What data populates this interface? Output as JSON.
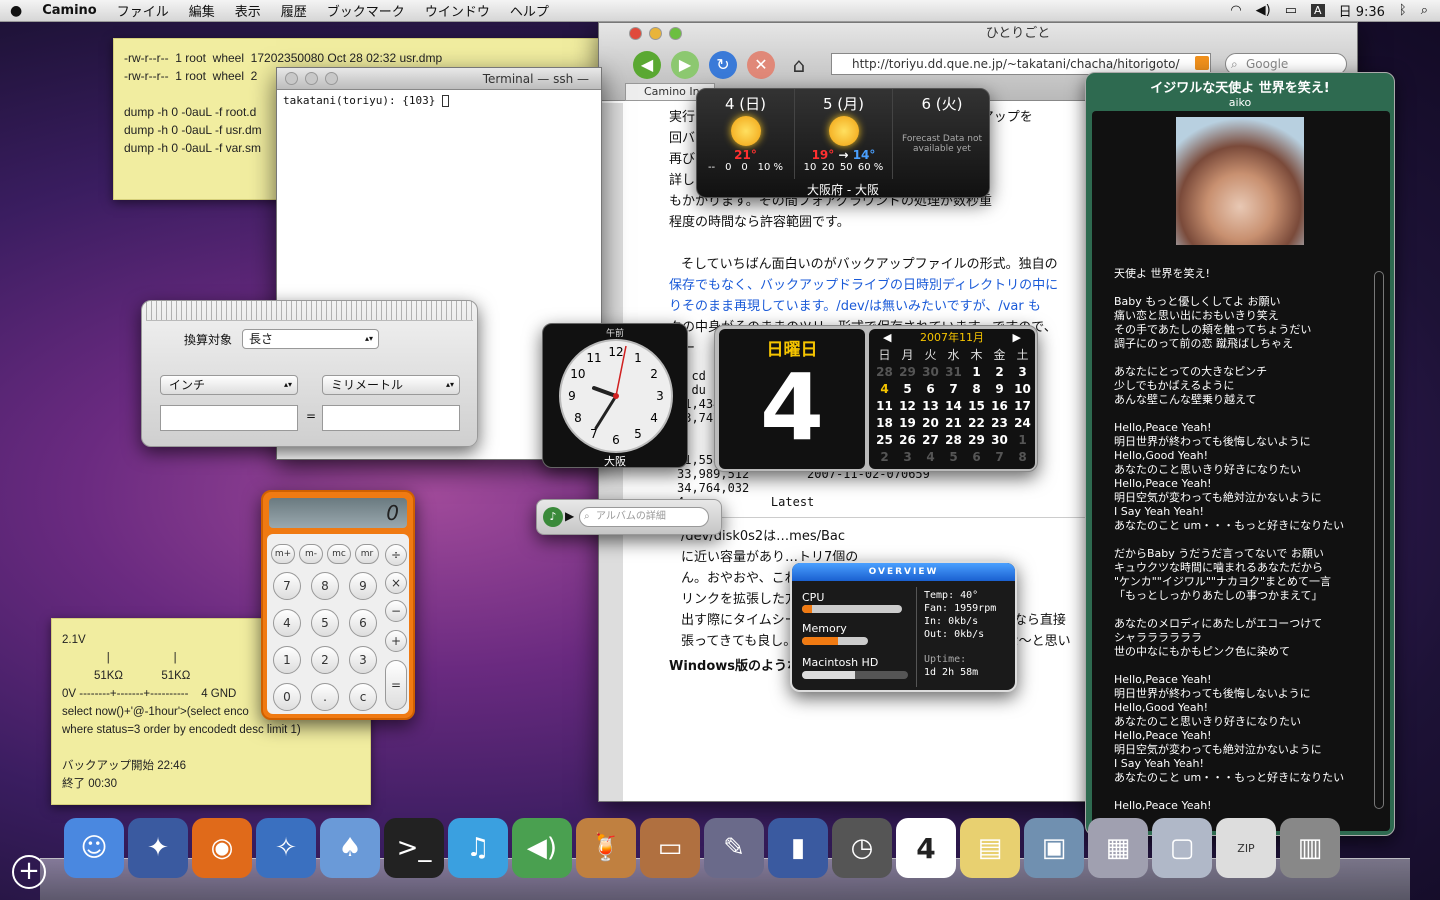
{
  "menubar": {
    "app": "Camino",
    "items": [
      "ファイル",
      "編集",
      "表示",
      "履歴",
      "ブックマーク",
      "ウインドウ",
      "ヘルプ"
    ],
    "clock": "日 9:36"
  },
  "sticky_top": {
    "lines": [
      "-rw-r--r--  1 root  wheel  17202350080 Oct 28 02:32 usr.dmp",
      "-rw-r--r--  1 root  wheel  2",
      "",
      "dump -h 0 -0auL -f root.d",
      "dump -h 0 -0auL -f usr.dm",
      "dump -h 0 -0auL -f var.sm"
    ]
  },
  "terminal": {
    "title": "Terminal — ssh —",
    "prompt": "takatani(toriyu): {103} "
  },
  "browser": {
    "title": "ひとりごと",
    "url": "http://toriyu.dd.que.ne.jp/~takatani/chacha/hitorigoto/",
    "search_placeholder": "Google",
    "tab": "Camino In",
    "text_lines": [
      "実行され…いますが、とりタイミングで手動にバックアップを",
      "回バック…はそこ…ぎるので設定がOFFなどでバ",
      "再び…n時間後の時刻",
      "詳し…プ時は2時間近",
      "もかかります。その間フォアグラウンドの処理が数秒重",
      "程度の時間なら許容範囲です。",
      "",
      "そしていちばん面白いのがバックアップファイルの形式。独自の",
      "保存でもなく、バックアップドライブの日時別ディレクトリの中に",
      "りそのまま再現しています。/dev/は無いみたいですが、/var も",
      "クの中身がそのままのツリー形式で保存されています。ですので、",
      "ハー"
    ],
    "pre_lines": [
      "% cd",
      "% du",
      "41,434,800        2007-11-01-003028",
      "33,747,784        2007-11-01-203350",
      "          164        2007-11-01-213408",
      "          488        2007-11-01-223346",
      "41,558,696        2007-11-01-233350",
      "33,989,512        2007-11-02-070659",
      "34,764,032",
      "4            Latest"
    ],
    "pre_side": [
      "able",
      "3,736",
      "5,424"
    ],
    "para2": [
      "/dev/disk0s2は…mes/Bac",
      "に近い容量があり…トリ7個の",
      "ん。おやおや、これ…していま",
      "リンクを拡張した方…ているのた",
      "出す際にタイムシーンのGUIを使ってもよいですし、面倒なら直接",
      "張ってきても良し。なんかMacOSXらしくてすごく良いな〜と思い"
    ],
    "bottom": "Windows版のようなプレビュー機能も"
  },
  "weather": {
    "days": [
      {
        "label": "4 (日)",
        "temp_hi": "21°",
        "temp_lo": "",
        "rain": [
          "--",
          "0",
          "0",
          "10 %"
        ]
      },
      {
        "label": "5 (月)",
        "temp_hi": "19°",
        "temp_lo": "14°",
        "rain": [
          "10",
          "20",
          "50",
          "60 %"
        ]
      },
      {
        "label": "6 (火)",
        "note": "Forecast Data not available yet"
      }
    ],
    "location": "大阪府 - 大阪"
  },
  "converter": {
    "label": "換算対象",
    "category": "長さ",
    "from": "インチ",
    "to": "ミリメートル",
    "equals": "="
  },
  "clock": {
    "ampm": "午前",
    "city": "大阪",
    "numbers": [
      "12",
      "1",
      "2",
      "3",
      "4",
      "5",
      "6",
      "7",
      "8",
      "9",
      "10",
      "11"
    ]
  },
  "calendar": {
    "dayname": "日曜日",
    "day": "4",
    "month": "2007年11月",
    "weekdays": [
      "日",
      "月",
      "火",
      "水",
      "木",
      "金",
      "土"
    ],
    "cells": [
      "28",
      "29",
      "30",
      "31",
      "1",
      "2",
      "3",
      "4",
      "5",
      "6",
      "7",
      "8",
      "9",
      "10",
      "11",
      "12",
      "13",
      "14",
      "15",
      "16",
      "17",
      "18",
      "19",
      "20",
      "21",
      "22",
      "23",
      "24",
      "25",
      "26",
      "27",
      "28",
      "29",
      "30",
      "1",
      "2",
      "3",
      "4",
      "5",
      "6",
      "7",
      "8"
    ]
  },
  "calculator": {
    "display": "0",
    "mem": [
      "m+",
      "m-",
      "mc",
      "mr"
    ],
    "ops": [
      "÷",
      "×",
      "−",
      "+",
      "="
    ],
    "digits": [
      "7",
      "8",
      "9",
      "4",
      "5",
      "6",
      "1",
      "2",
      "3",
      "0",
      ".",
      "c"
    ]
  },
  "itunes": {
    "placeholder": "アルバムの詳細"
  },
  "sticky_bottom": {
    "lines": [
      "2.1V",
      "              |                    |",
      "          51KΩ            51KΩ",
      "0V --------+-------+----------    4 GND",
      "select now()+'@-1hour'>(select enco",
      "where status=3 order by encodedt desc limit 1)",
      "",
      "バックアップ開始 22:46",
      "終了 00:30"
    ]
  },
  "istat": {
    "title": "OVERVIEW",
    "cpu": "CPU",
    "memory": "Memory",
    "disk": "Macintosh HD",
    "temp": "Temp: 40°",
    "fan": "Fan: 1959rpm",
    "in": "In: 0kb/s",
    "out": "Out: 0kb/s",
    "uptime_label": "Uptime:",
    "uptime": "1d 2h 58m",
    "cpu_level": 0.1,
    "mem_level": 0.55,
    "disk_level": 0.5
  },
  "lyrics": {
    "title": "イジワルな天使よ 世界を笑え!",
    "artist": "aiko",
    "lines": [
      "天使よ 世界を笑え!",
      "",
      "Baby もっと優しくしてよ お願い",
      "痛い恋と思い出におもいきり笑え",
      "その手であたしの頬を触ってちょうだい",
      "調子にのって前の恋 蹴飛ばしちゃえ",
      "",
      "あなたにとっての大きなピンチ",
      "少しでもかばえるように",
      "あんな壁こんな壁乗り越えて",
      "",
      "Hello,Peace Yeah!",
      "明日世界が終わっても後悔しないように",
      "Hello,Good Yeah!",
      "あなたのこと思いきり好きになりたい",
      "Hello,Peace Yeah!",
      "明日空気が変わっても絶対泣かないように",
      "I Say Yeah Yeah!",
      "あなたのこと um・・・もっと好きになりたい",
      "",
      "だからBaby うだうだ言ってないで お願い",
      "キュウクツな時間に噛まれるあなただから",
      "\"ケンカ\"\"イジワル\"\"ナカヨク\"まとめて一言",
      "「もっとしっかりあたしの事つかまえて」",
      "",
      "あなたのメロディにあたしがエコーつけて",
      "シャララララララ",
      "世の中なにもかもピンク色に染めて",
      "",
      "Hello,Peace Yeah!",
      "明日世界が終わっても後悔しないように",
      "Hello,Good Yeah!",
      "あなたのこと思いきり好きになりたい",
      "Hello,Peace Yeah!",
      "明日空気が変わっても絶対泣かないように",
      "I Say Yeah Yeah!",
      "あなたのこと um・・・もっと好きになりたい",
      "",
      "Hello,Peace Yeah!"
    ]
  },
  "dock": {
    "icons": [
      "finder-icon",
      "network-icon",
      "firefox-icon",
      "safari-icon",
      "character-icon",
      "terminal-icon",
      "itunes-icon",
      "audio-icon",
      "cocktail-icon",
      "presentation-icon",
      "pen-icon",
      "charts-icon",
      "time-machine-icon",
      "ical-icon",
      "stickies-icon",
      "photo-icon",
      "photo-stack-icon",
      "folder-icon",
      "zip-icon",
      "trash-icon"
    ],
    "ical_day": "4",
    "zip": "ZIP",
    "add": "+"
  }
}
